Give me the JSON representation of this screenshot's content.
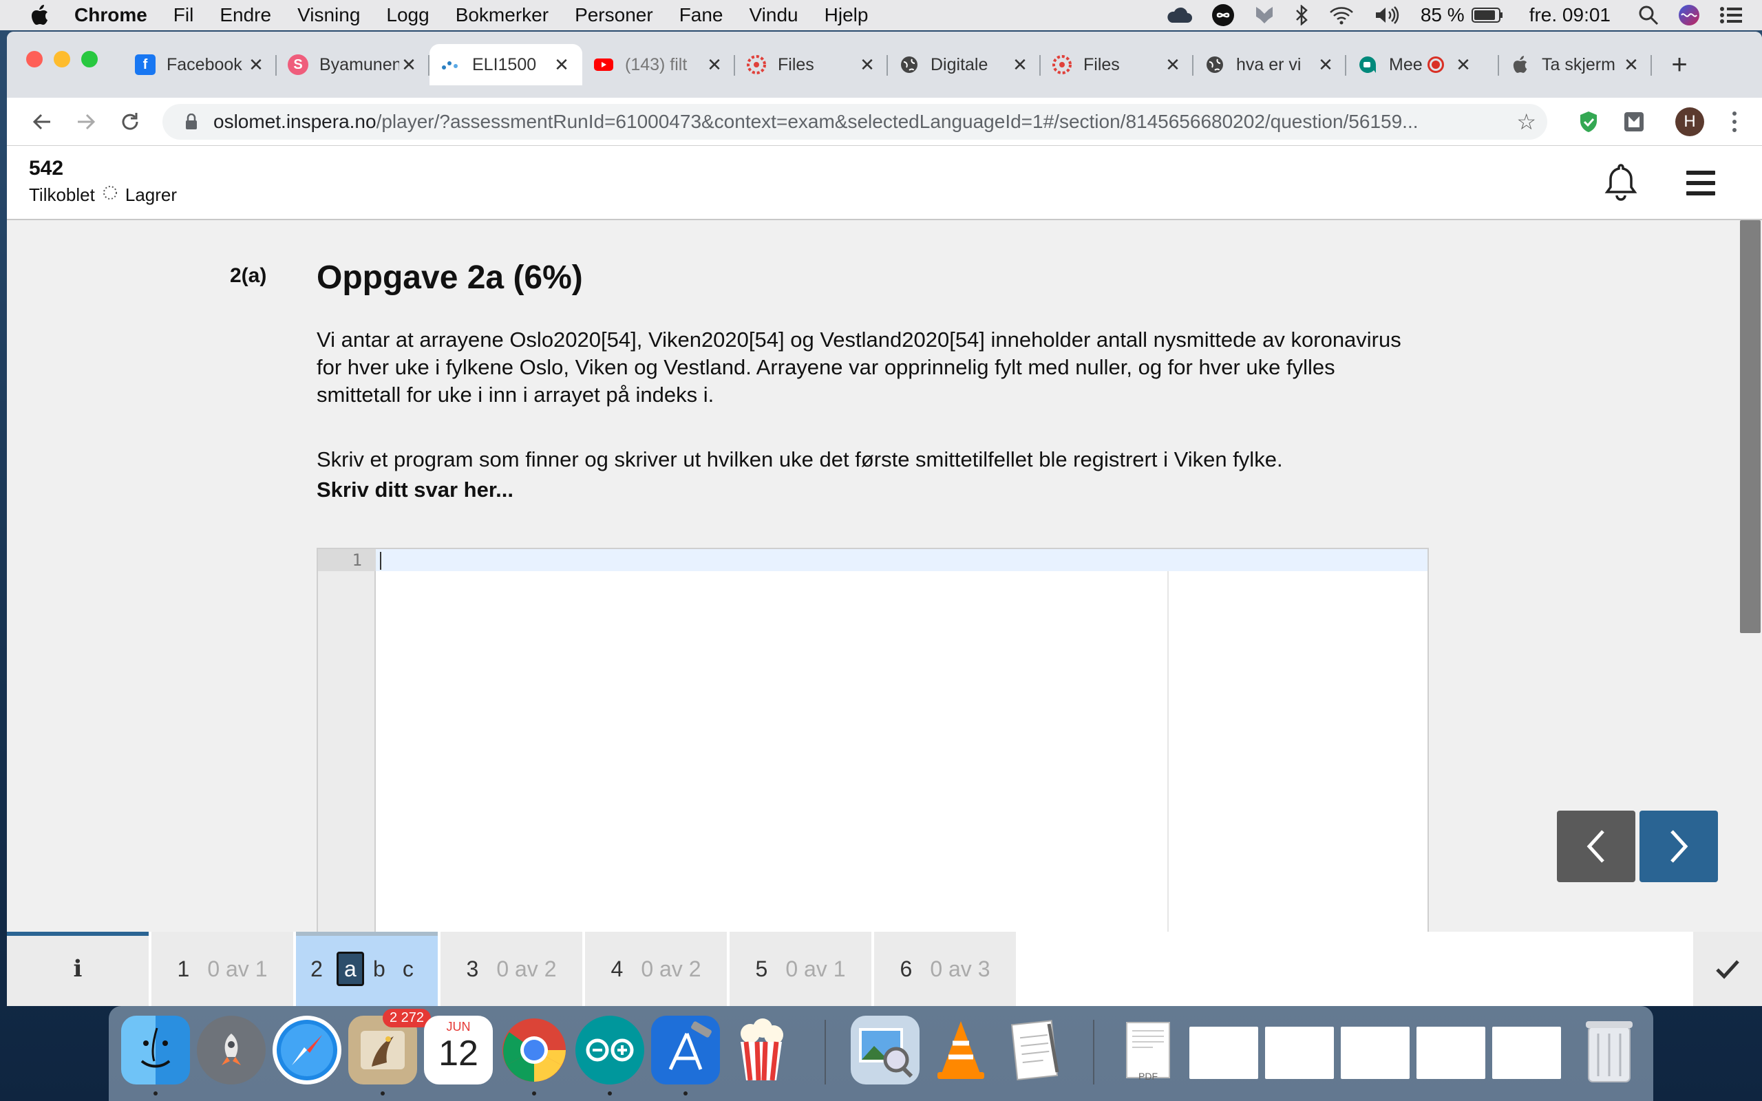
{
  "menubar": {
    "app_name": "Chrome",
    "menus": [
      "Fil",
      "Endre",
      "Visning",
      "Logg",
      "Bokmerker",
      "Personer",
      "Fane",
      "Vindu",
      "Hjelp"
    ],
    "battery": "85 %",
    "clock": "fre. 09:01"
  },
  "browser": {
    "tabs": [
      {
        "title": "Facebook",
        "favicon": "facebook-icon",
        "color": "#1877f2"
      },
      {
        "title": "Byamunen",
        "favicon": "byamunen-icon",
        "color": "#ef5d7c"
      },
      {
        "title": "ELI1500",
        "favicon": "inspera-icon",
        "color": "#2a7fc1",
        "active": true
      },
      {
        "title": "(143) filt",
        "favicon": "youtube-icon",
        "color": "#ff0000"
      },
      {
        "title": "Files",
        "favicon": "canvas-icon",
        "color": "#e0403a"
      },
      {
        "title": "Digitale",
        "favicon": "globe-icon",
        "color": "#444"
      },
      {
        "title": "Files",
        "favicon": "canvas-icon",
        "color": "#e0403a"
      },
      {
        "title": "hva er vi",
        "favicon": "globe-icon",
        "color": "#444"
      },
      {
        "title": "Mee",
        "favicon": "meet-icon",
        "color": "#00897b"
      },
      {
        "title": "Ta skjerm",
        "favicon": "apple-icon",
        "color": "#555"
      }
    ],
    "url_host": "oslomet.inspera.no",
    "url_path": "/player/?assessmentRunId=61000473&context=exam&selectedLanguageId=1#/section/8145656680202/question/56159...",
    "avatar_letter": "H"
  },
  "exam": {
    "candidate_number": "542",
    "connection_status": "Tilkoblet",
    "save_status": "Lagrer",
    "question_number": "2(a)",
    "question_title": "Oppgave 2a (6%)",
    "paragraph1": "Vi antar at arrayene Oslo2020[54], Viken2020[54] og Vestland2020[54] inneholder antall nysmittede av koronavirus for hver uke i fylkene Oslo, Viken og Vestland. Arrayene var opprinnelig fylt med nuller, og for hver uke fylles smittetall for uke i inn i arrayet på indeks i.",
    "paragraph2": "Skriv et program som finner og skriver ut hvilken uke det første smittetilfellet ble registrert i Viken fylke.",
    "answer_label": "Skriv ditt svar her...",
    "editor_line": "1"
  },
  "question_nav": {
    "info_label": "i",
    "items": [
      {
        "number": "1",
        "progress": "0 av 1"
      },
      {
        "number": "2",
        "subs": [
          "a",
          "b",
          "c"
        ],
        "current_sub": "a"
      },
      {
        "number": "3",
        "progress": "0 av 2"
      },
      {
        "number": "4",
        "progress": "0 av 2"
      },
      {
        "number": "5",
        "progress": "0 av 1"
      },
      {
        "number": "6",
        "progress": "0 av 3"
      }
    ]
  },
  "dock": {
    "mail_badge": "2 272",
    "calendar_month": "JUN",
    "calendar_day": "12",
    "pdf_label": "PDF"
  },
  "colors": {
    "accent": "#2a6493",
    "active_question": "#b8d8f8"
  }
}
